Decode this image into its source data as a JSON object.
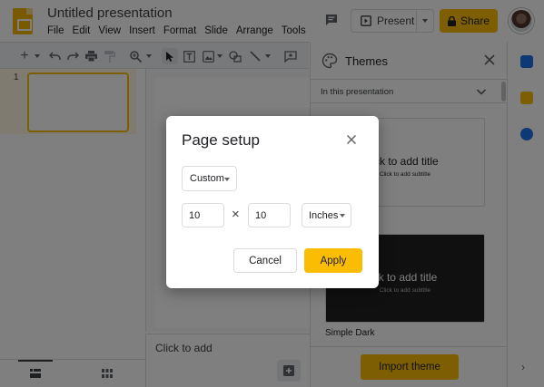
{
  "header": {
    "doc_title": "Untitled presentation",
    "menu": [
      "File",
      "Edit",
      "View",
      "Insert",
      "Format",
      "Slide",
      "Arrange",
      "Tools"
    ],
    "present_label": "Present",
    "share_label": "Share",
    "icons": [
      "slides-logo-icon",
      "comment-icon",
      "present-icon",
      "lock-icon",
      "avatar"
    ]
  },
  "filmstrip": {
    "slide_number": "1"
  },
  "notes": {
    "placeholder": "Click to add"
  },
  "themes": {
    "title": "Themes",
    "section": "In this presentation",
    "cards": [
      {
        "title": "ick to add title",
        "subtitle": "Click to add subtitle"
      },
      {
        "title": "ck to add title",
        "subtitle": "Click to add subtitle"
      }
    ],
    "theme_name": "Simple Dark",
    "import_label": "Import theme"
  },
  "dialog": {
    "title": "Page setup",
    "preset": "Custom",
    "width": "10",
    "height": "10",
    "times_symbol": "×",
    "unit": "Inches",
    "cancel_label": "Cancel",
    "apply_label": "Apply"
  },
  "colors": {
    "accent": "#fbbc04",
    "scrim": "rgba(0,0,0,0.5)"
  }
}
